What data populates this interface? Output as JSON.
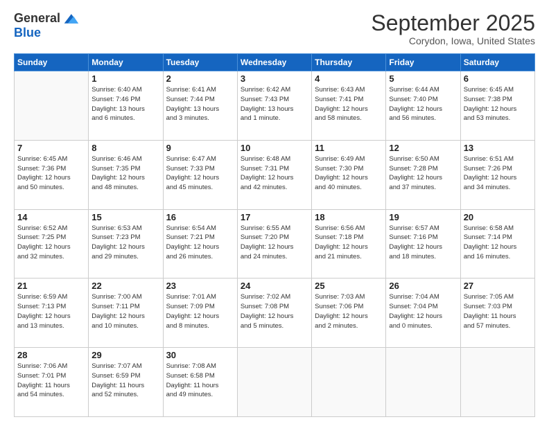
{
  "logo": {
    "general": "General",
    "blue": "Blue"
  },
  "title": "September 2025",
  "location": "Corydon, Iowa, United States",
  "days_of_week": [
    "Sunday",
    "Monday",
    "Tuesday",
    "Wednesday",
    "Thursday",
    "Friday",
    "Saturday"
  ],
  "weeks": [
    [
      {
        "day": "",
        "info": ""
      },
      {
        "day": "1",
        "info": "Sunrise: 6:40 AM\nSunset: 7:46 PM\nDaylight: 13 hours\nand 6 minutes."
      },
      {
        "day": "2",
        "info": "Sunrise: 6:41 AM\nSunset: 7:44 PM\nDaylight: 13 hours\nand 3 minutes."
      },
      {
        "day": "3",
        "info": "Sunrise: 6:42 AM\nSunset: 7:43 PM\nDaylight: 13 hours\nand 1 minute."
      },
      {
        "day": "4",
        "info": "Sunrise: 6:43 AM\nSunset: 7:41 PM\nDaylight: 12 hours\nand 58 minutes."
      },
      {
        "day": "5",
        "info": "Sunrise: 6:44 AM\nSunset: 7:40 PM\nDaylight: 12 hours\nand 56 minutes."
      },
      {
        "day": "6",
        "info": "Sunrise: 6:45 AM\nSunset: 7:38 PM\nDaylight: 12 hours\nand 53 minutes."
      }
    ],
    [
      {
        "day": "7",
        "info": "Sunrise: 6:45 AM\nSunset: 7:36 PM\nDaylight: 12 hours\nand 50 minutes."
      },
      {
        "day": "8",
        "info": "Sunrise: 6:46 AM\nSunset: 7:35 PM\nDaylight: 12 hours\nand 48 minutes."
      },
      {
        "day": "9",
        "info": "Sunrise: 6:47 AM\nSunset: 7:33 PM\nDaylight: 12 hours\nand 45 minutes."
      },
      {
        "day": "10",
        "info": "Sunrise: 6:48 AM\nSunset: 7:31 PM\nDaylight: 12 hours\nand 42 minutes."
      },
      {
        "day": "11",
        "info": "Sunrise: 6:49 AM\nSunset: 7:30 PM\nDaylight: 12 hours\nand 40 minutes."
      },
      {
        "day": "12",
        "info": "Sunrise: 6:50 AM\nSunset: 7:28 PM\nDaylight: 12 hours\nand 37 minutes."
      },
      {
        "day": "13",
        "info": "Sunrise: 6:51 AM\nSunset: 7:26 PM\nDaylight: 12 hours\nand 34 minutes."
      }
    ],
    [
      {
        "day": "14",
        "info": "Sunrise: 6:52 AM\nSunset: 7:25 PM\nDaylight: 12 hours\nand 32 minutes."
      },
      {
        "day": "15",
        "info": "Sunrise: 6:53 AM\nSunset: 7:23 PM\nDaylight: 12 hours\nand 29 minutes."
      },
      {
        "day": "16",
        "info": "Sunrise: 6:54 AM\nSunset: 7:21 PM\nDaylight: 12 hours\nand 26 minutes."
      },
      {
        "day": "17",
        "info": "Sunrise: 6:55 AM\nSunset: 7:20 PM\nDaylight: 12 hours\nand 24 minutes."
      },
      {
        "day": "18",
        "info": "Sunrise: 6:56 AM\nSunset: 7:18 PM\nDaylight: 12 hours\nand 21 minutes."
      },
      {
        "day": "19",
        "info": "Sunrise: 6:57 AM\nSunset: 7:16 PM\nDaylight: 12 hours\nand 18 minutes."
      },
      {
        "day": "20",
        "info": "Sunrise: 6:58 AM\nSunset: 7:14 PM\nDaylight: 12 hours\nand 16 minutes."
      }
    ],
    [
      {
        "day": "21",
        "info": "Sunrise: 6:59 AM\nSunset: 7:13 PM\nDaylight: 12 hours\nand 13 minutes."
      },
      {
        "day": "22",
        "info": "Sunrise: 7:00 AM\nSunset: 7:11 PM\nDaylight: 12 hours\nand 10 minutes."
      },
      {
        "day": "23",
        "info": "Sunrise: 7:01 AM\nSunset: 7:09 PM\nDaylight: 12 hours\nand 8 minutes."
      },
      {
        "day": "24",
        "info": "Sunrise: 7:02 AM\nSunset: 7:08 PM\nDaylight: 12 hours\nand 5 minutes."
      },
      {
        "day": "25",
        "info": "Sunrise: 7:03 AM\nSunset: 7:06 PM\nDaylight: 12 hours\nand 2 minutes."
      },
      {
        "day": "26",
        "info": "Sunrise: 7:04 AM\nSunset: 7:04 PM\nDaylight: 12 hours\nand 0 minutes."
      },
      {
        "day": "27",
        "info": "Sunrise: 7:05 AM\nSunset: 7:03 PM\nDaylight: 11 hours\nand 57 minutes."
      }
    ],
    [
      {
        "day": "28",
        "info": "Sunrise: 7:06 AM\nSunset: 7:01 PM\nDaylight: 11 hours\nand 54 minutes."
      },
      {
        "day": "29",
        "info": "Sunrise: 7:07 AM\nSunset: 6:59 PM\nDaylight: 11 hours\nand 52 minutes."
      },
      {
        "day": "30",
        "info": "Sunrise: 7:08 AM\nSunset: 6:58 PM\nDaylight: 11 hours\nand 49 minutes."
      },
      {
        "day": "",
        "info": ""
      },
      {
        "day": "",
        "info": ""
      },
      {
        "day": "",
        "info": ""
      },
      {
        "day": "",
        "info": ""
      }
    ]
  ]
}
